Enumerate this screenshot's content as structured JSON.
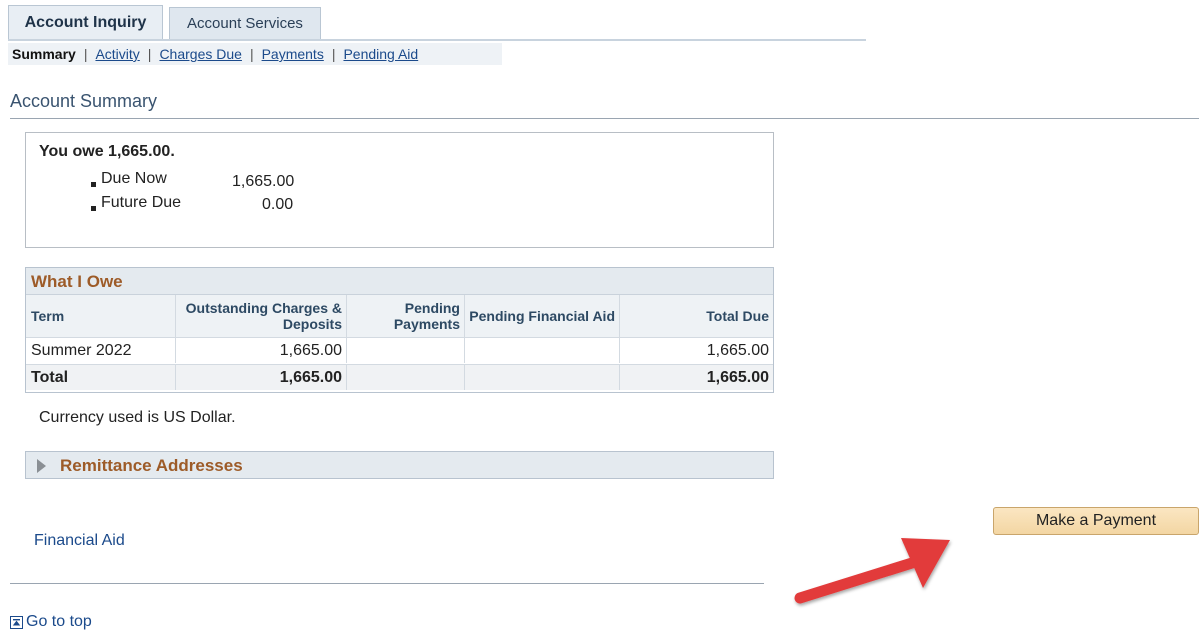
{
  "tabs": [
    {
      "label": "Account Inquiry",
      "active": true
    },
    {
      "label": "Account Services",
      "active": false
    }
  ],
  "subnav": [
    "Summary",
    "Activity",
    "Charges Due",
    "Payments",
    "Pending Aid"
  ],
  "page_title": "Account Summary",
  "owe": {
    "heading": "You owe 1,665.00.",
    "items": [
      {
        "label": "Due Now",
        "value": "1,665.00"
      },
      {
        "label": "Future Due",
        "value": "0.00"
      }
    ]
  },
  "grid": {
    "title": "What I Owe",
    "headers": [
      "Term",
      "Outstanding Charges & Deposits",
      "Pending Payments",
      "Pending Financial Aid",
      "Total Due"
    ],
    "rows": [
      {
        "term": "Summer 2022",
        "charges": "1,665.00",
        "payments": "",
        "aid": "",
        "total": "1,665.00"
      }
    ],
    "total_row": {
      "term": "Total",
      "charges": "1,665.00",
      "payments": "",
      "aid": "",
      "total": "1,665.00"
    }
  },
  "currency_note": "Currency used is US Dollar.",
  "remittance_label": "Remittance Addresses",
  "financial_aid_link": "Financial Aid",
  "make_payment_label": "Make a Payment",
  "go_to_top_label": "Go to top",
  "colors": {
    "accent": "#9d5b28",
    "link": "#1b4a8b",
    "arrow": "#e23b3b"
  }
}
